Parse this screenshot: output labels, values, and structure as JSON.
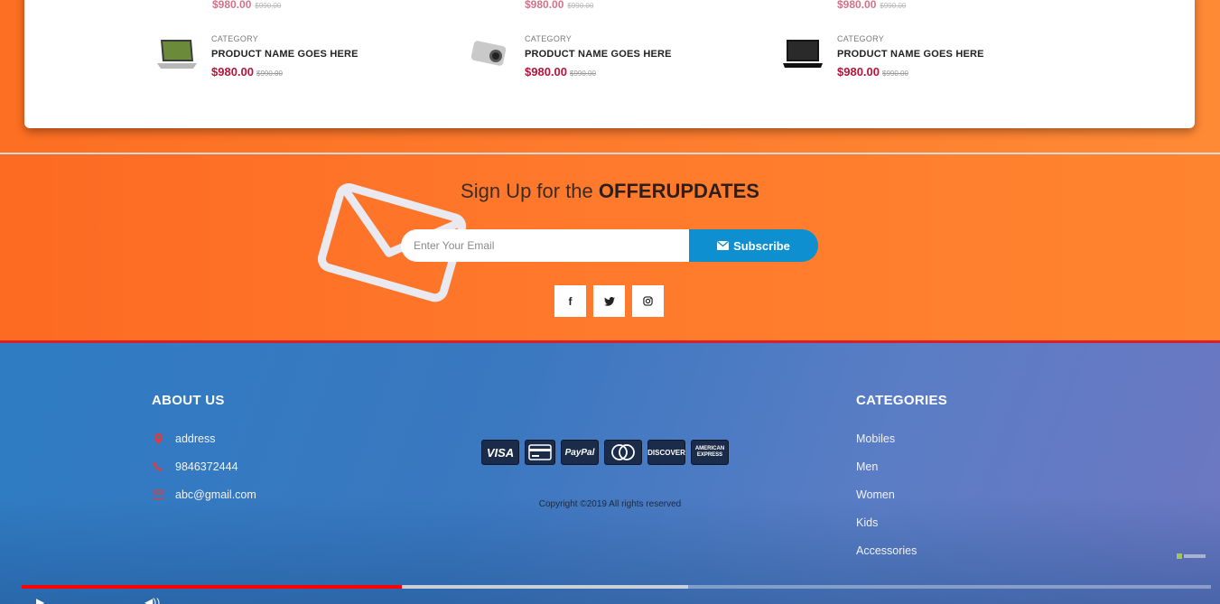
{
  "products": [
    {
      "category": "CATEGORY",
      "name": "PRODUCT NAME GOES HERE",
      "price": "$980.00",
      "old_price": "$990.00",
      "icon": "laptop-icon"
    },
    {
      "category": "CATEGORY",
      "name": "PRODUCT NAME GOES HERE",
      "price": "$980.00",
      "old_price": "$990.00",
      "icon": "camera-icon"
    },
    {
      "category": "CATEGORY",
      "name": "PRODUCT NAME GOES HERE",
      "price": "$980.00",
      "old_price": "$990.00",
      "icon": "laptop-icon"
    }
  ],
  "ghost_prices": {
    "price": "$980.00",
    "old_price": "$990.00"
  },
  "newsletter": {
    "title_prefix": "Sign Up for the ",
    "title_strong": "OFFERUPDATES",
    "email_placeholder": "Enter Your Email",
    "subscribe_label": "Subscribe",
    "social": [
      {
        "icon": "facebook-icon",
        "glyph": "f"
      },
      {
        "icon": "twitter-icon",
        "glyph": "t"
      },
      {
        "icon": "instagram-icon",
        "glyph": "◎"
      }
    ]
  },
  "footer": {
    "about_heading": "ABOUT US",
    "about_items": [
      {
        "icon": "location-pin-icon",
        "text": "address"
      },
      {
        "icon": "phone-icon",
        "text": "9846372444"
      },
      {
        "icon": "envelope-icon",
        "text": "abc@gmail.com"
      }
    ],
    "payment_cards": [
      "VISA",
      "",
      "PayPal",
      "",
      "DISCOVER",
      "AMERICAN EXPRESS"
    ],
    "copyright": "Copyright ©2019 All rights reserved",
    "categories_heading": "CATEGORIES",
    "categories": [
      "Mobiles",
      "Men",
      "Women",
      "Kids",
      "Accessories"
    ]
  },
  "video": {
    "progress_played": 0.32,
    "progress_buffered": 0.56
  },
  "colors": {
    "price": "#b5163a",
    "subscribe": "#0d8fd0",
    "orange": "#fe7b2d",
    "footer_blue": "#3a78c0"
  }
}
